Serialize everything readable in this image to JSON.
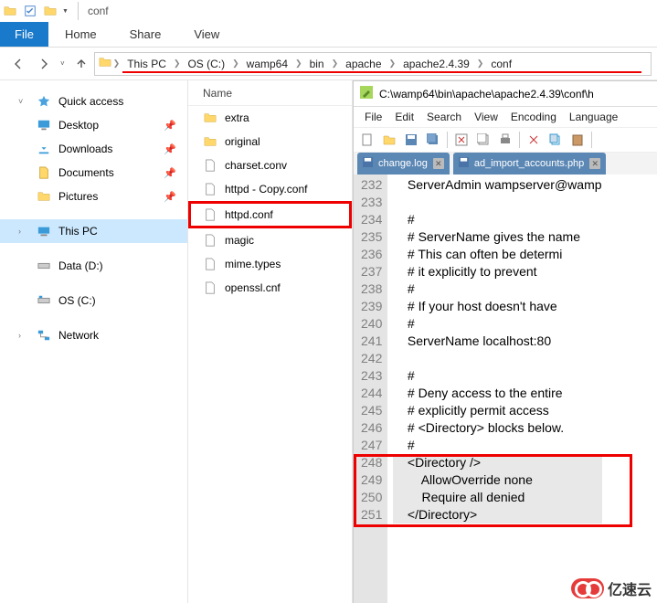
{
  "titlebar": {
    "title": "conf"
  },
  "ribbon": {
    "file": "File",
    "tabs": [
      "Home",
      "Share",
      "View"
    ]
  },
  "breadcrumb": [
    "This PC",
    "OS (C:)",
    "wamp64",
    "bin",
    "apache",
    "apache2.4.39",
    "conf"
  ],
  "nav": {
    "quick": "Quick access",
    "quick_items": [
      {
        "label": "Desktop",
        "pin": true
      },
      {
        "label": "Downloads",
        "pin": true
      },
      {
        "label": "Documents",
        "pin": true
      },
      {
        "label": "Pictures",
        "pin": true
      }
    ],
    "thispc": "This PC",
    "drives": [
      {
        "label": "Data (D:)"
      },
      {
        "label": "OS (C:)"
      }
    ],
    "network": "Network"
  },
  "files": {
    "header": "Name",
    "items": [
      {
        "label": "extra",
        "type": "folder"
      },
      {
        "label": "original",
        "type": "folder"
      },
      {
        "label": "charset.conv",
        "type": "file"
      },
      {
        "label": "httpd - Copy.conf",
        "type": "file"
      },
      {
        "label": "httpd.conf",
        "type": "file",
        "highlight": true
      },
      {
        "label": "magic",
        "type": "file"
      },
      {
        "label": "mime.types",
        "type": "file"
      },
      {
        "label": "openssl.cnf",
        "type": "file"
      }
    ]
  },
  "editor": {
    "title": "C:\\wamp64\\bin\\apache\\apache2.4.39\\conf\\h",
    "menu": [
      "File",
      "Edit",
      "Search",
      "View",
      "Encoding",
      "Language"
    ],
    "tabs": [
      {
        "label": "change.log"
      },
      {
        "label": "ad_import_accounts.php"
      }
    ],
    "lines": [
      {
        "n": 232,
        "t": "    ServerAdmin wampserver@wamp"
      },
      {
        "n": 233,
        "t": ""
      },
      {
        "n": 234,
        "t": "    #"
      },
      {
        "n": 235,
        "t": "    # ServerName gives the name"
      },
      {
        "n": 236,
        "t": "    # This can often be determi"
      },
      {
        "n": 237,
        "t": "    # it explicitly to prevent "
      },
      {
        "n": 238,
        "t": "    #"
      },
      {
        "n": 239,
        "t": "    # If your host doesn't have"
      },
      {
        "n": 240,
        "t": "    #"
      },
      {
        "n": 241,
        "t": "    ServerName localhost:80"
      },
      {
        "n": 242,
        "t": ""
      },
      {
        "n": 243,
        "t": "    #"
      },
      {
        "n": 244,
        "t": "    # Deny access to the entire"
      },
      {
        "n": 245,
        "t": "    # explicitly permit access "
      },
      {
        "n": 246,
        "t": "    # <Directory> blocks below."
      },
      {
        "n": 247,
        "t": "    #"
      },
      {
        "n": 248,
        "t": "    <Directory />",
        "hl": true
      },
      {
        "n": 249,
        "t": "        AllowOverride none",
        "hl": true
      },
      {
        "n": 250,
        "t": "        Require all denied",
        "hl": true
      },
      {
        "n": 251,
        "t": "    </Directory>",
        "hl": true
      }
    ]
  },
  "watermark": "亿速云"
}
